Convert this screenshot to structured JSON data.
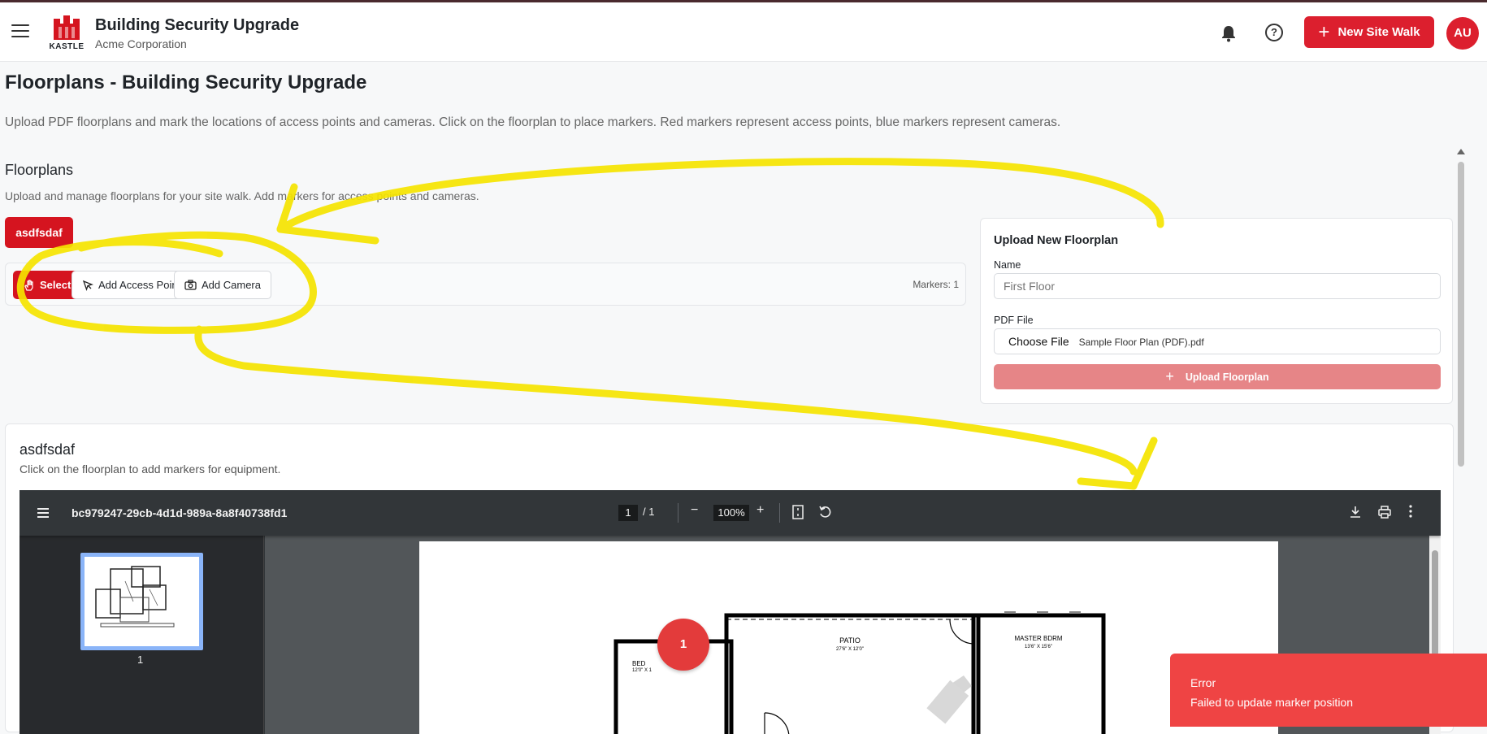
{
  "header": {
    "app_title": "Building Security Upgrade",
    "org_name": "Acme Corporation",
    "logo_text": "KASTLE",
    "new_site_walk_label": "New Site Walk",
    "avatar_initials": "AU",
    "brand_color": "#dc1f2e"
  },
  "page": {
    "title": "Floorplans - Building Security Upgrade",
    "description": "Upload PDF floorplans and mark the locations of access points and cameras. Click on the floorplan to place markers. Red markers represent access points, blue markers represent cameras."
  },
  "floorplans": {
    "title": "Floorplans",
    "description": "Upload and manage floorplans for your site walk. Add markers for access points and cameras.",
    "tabs": [
      {
        "label": "asdfsdaf"
      }
    ],
    "toolbar": {
      "select_label": "Select",
      "add_access_point_label": "Add Access Point",
      "add_camera_label": "Add Camera",
      "marker_count": "Markers: 1"
    }
  },
  "upload": {
    "title": "Upload New Floorplan",
    "name_label": "Name",
    "name_placeholder": "First Floor",
    "file_label": "PDF File",
    "choose_file_label": "Choose File",
    "file_name": "Sample Floor Plan (PDF).pdf",
    "button_label": "Upload Floorplan"
  },
  "viewer": {
    "title": "asdfsdaf",
    "description": "Click on the floorplan to add markers for equipment.",
    "pdf": {
      "file_name": "bc979247-29cb-4d1d-989a-8a8f40738fd1",
      "current_page": "1",
      "page_total": "/ 1",
      "zoom": "100%",
      "thumbnail_label": "1"
    },
    "plan_labels": {
      "patio": "PATIO",
      "patio_size": "27'6\" X 12'0\"",
      "master": "MASTER BDRM",
      "master_size": "13'6\" X 15'6\"",
      "bedroom": "BED",
      "bedroom_size": "12'0\" X 1"
    },
    "marker_label": "1"
  },
  "toast": {
    "title": "Error",
    "message": "Failed to update marker position"
  }
}
